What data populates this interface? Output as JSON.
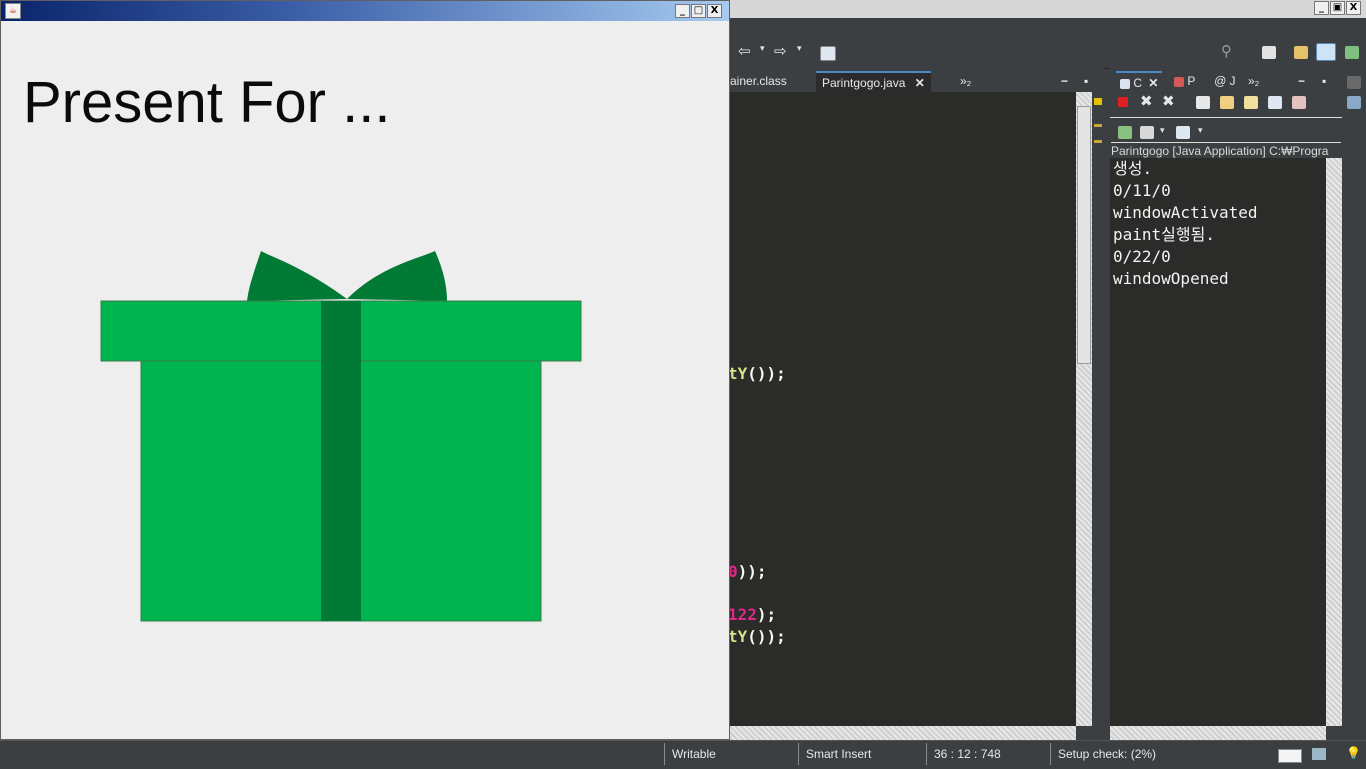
{
  "frame": {
    "window_buttons": [
      "_",
      "□",
      "X"
    ],
    "java_icon": "java-cup-icon",
    "heading": "Present For ..."
  },
  "gift": {
    "box_color": "#00b44f",
    "ribbon_color": "#007a35",
    "outline_color": "#3a7a4a"
  },
  "eclipse": {
    "window_buttons": [
      "_",
      "▣",
      "X"
    ],
    "editor_tabs": [
      {
        "label": "ainer.class",
        "active": false
      },
      {
        "label": "Parintgogo.java",
        "active": true,
        "close": "✕"
      }
    ],
    "editor_tabs_overflow": "»₂",
    "code_lines": [
      {
        "pre": "",
        "fn": "tY",
        "num": "",
        "post": "());"
      },
      {
        "pre": "",
        "fn": "",
        "num": "0",
        "post": "));"
      },
      {
        "pre": "",
        "fn": "",
        "num": "122",
        "post": ");"
      },
      {
        "pre": "",
        "fn": "tY",
        "num": "",
        "post": "());"
      }
    ],
    "console_tabs": [
      {
        "label": "C",
        "close": "✕"
      },
      {
        "label": "P"
      },
      {
        "label": "J"
      }
    ],
    "console_tabs_overflow": "»₂",
    "console_description": "Parintgogo [Java Application] C:₩Progra",
    "console_lines": [
      "생성.",
      "0/11/0",
      "windowActivated",
      "paint실행됨.",
      "0/22/0",
      "windowOpened"
    ],
    "status": {
      "writable": "Writable",
      "insert_mode": "Smart Insert",
      "position": "36 : 12 : 748",
      "setup_check": "Setup check: (2%)"
    },
    "icons": [
      "back-arrow-icon",
      "forward-arrow-icon",
      "open-editor-icon",
      "search-icon",
      "perspective-icon",
      "debug-perspective-icon",
      "terminate-icon",
      "remove-launch-icon",
      "remove-all-icon",
      "lightbulb-icon"
    ]
  }
}
